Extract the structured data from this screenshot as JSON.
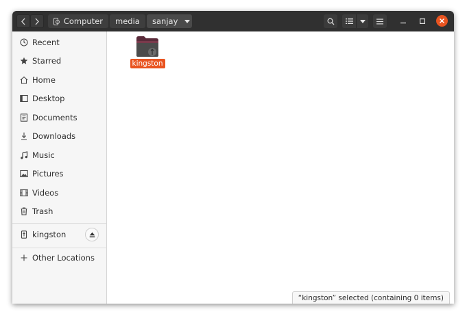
{
  "breadcrumb": {
    "items": [
      "Computer",
      "media",
      "sanjay"
    ]
  },
  "sidebar": {
    "items": [
      {
        "label": "Recent",
        "icon": "clock-icon"
      },
      {
        "label": "Starred",
        "icon": "star-icon"
      },
      {
        "label": "Home",
        "icon": "home-icon"
      },
      {
        "label": "Desktop",
        "icon": "desktop-icon"
      },
      {
        "label": "Documents",
        "icon": "document-icon"
      },
      {
        "label": "Downloads",
        "icon": "download-icon"
      },
      {
        "label": "Music",
        "icon": "music-icon"
      },
      {
        "label": "Pictures",
        "icon": "picture-icon"
      },
      {
        "label": "Videos",
        "icon": "video-icon"
      },
      {
        "label": "Trash",
        "icon": "trash-icon"
      }
    ],
    "device": {
      "label": "kingston",
      "icon": "usb-drive-icon"
    },
    "other": {
      "label": "Other Locations",
      "icon": "plus-icon"
    }
  },
  "content": {
    "files": [
      {
        "name": "kingston",
        "type": "folder",
        "selected": true
      }
    ]
  },
  "status": {
    "text": "“kingston” selected  (containing 0 items)"
  },
  "colors": {
    "accent": "#e95420",
    "headerbar": "#303030",
    "sidebar_bg": "#f6f6f6"
  }
}
